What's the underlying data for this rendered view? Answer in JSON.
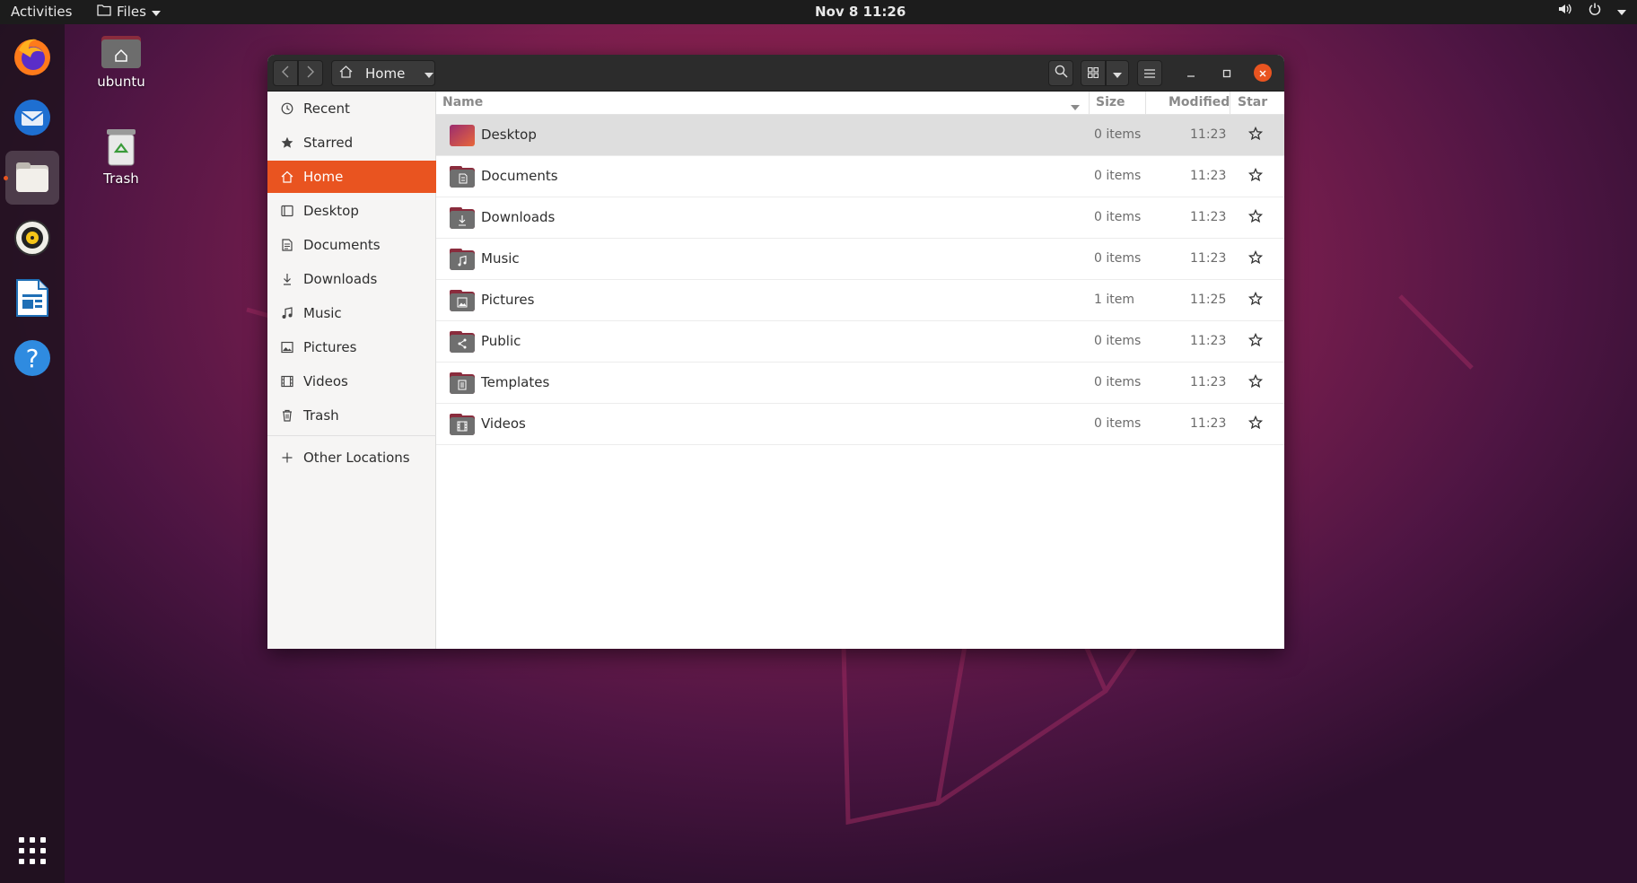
{
  "topbar": {
    "activities": "Activities",
    "app_menu": "Files",
    "clock": "Nov 8  11:26"
  },
  "desktop_icons": {
    "home_label": "ubuntu",
    "trash_label": "Trash"
  },
  "dock": {
    "items": [
      "firefox-icon",
      "thunderbird-icon",
      "files-icon",
      "rhythmbox-icon",
      "writer-icon",
      "help-icon",
      "app-grid-icon"
    ]
  },
  "window": {
    "path_label": "Home",
    "accent": "#e95420"
  },
  "sidebar": {
    "items": [
      {
        "label": "Recent",
        "icon": "clock-icon"
      },
      {
        "label": "Starred",
        "icon": "star-icon"
      },
      {
        "label": "Home",
        "icon": "home-icon"
      },
      {
        "label": "Desktop",
        "icon": "desktop-icon"
      },
      {
        "label": "Documents",
        "icon": "document-icon"
      },
      {
        "label": "Downloads",
        "icon": "download-icon"
      },
      {
        "label": "Music",
        "icon": "music-icon"
      },
      {
        "label": "Pictures",
        "icon": "picture-icon"
      },
      {
        "label": "Videos",
        "icon": "video-icon"
      },
      {
        "label": "Trash",
        "icon": "trash-icon"
      }
    ],
    "other_locations": "Other Locations"
  },
  "columns": {
    "name": "Name",
    "size": "Size",
    "modified": "Modified",
    "star": "Star"
  },
  "files": [
    {
      "name": "Desktop",
      "size": "0 items",
      "modified": "11:23"
    },
    {
      "name": "Documents",
      "size": "0 items",
      "modified": "11:23"
    },
    {
      "name": "Downloads",
      "size": "0 items",
      "modified": "11:23"
    },
    {
      "name": "Music",
      "size": "0 items",
      "modified": "11:23"
    },
    {
      "name": "Pictures",
      "size": "1 item",
      "modified": "11:25"
    },
    {
      "name": "Public",
      "size": "0 items",
      "modified": "11:23"
    },
    {
      "name": "Templates",
      "size": "0 items",
      "modified": "11:23"
    },
    {
      "name": "Videos",
      "size": "0 items",
      "modified": "11:23"
    }
  ]
}
